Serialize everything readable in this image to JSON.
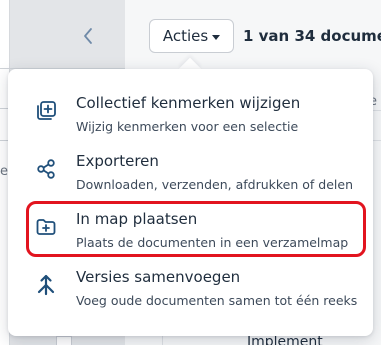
{
  "toolbar": {
    "actions_label": "Acties",
    "doc_count": "1 van 34 documen"
  },
  "menu": {
    "items": [
      {
        "icon": "collection-edit-icon",
        "title": "Collectief kenmerken wijzigen",
        "desc": "Wijzig kenmerken voor een selectie"
      },
      {
        "icon": "share-icon",
        "title": "Exporteren",
        "desc": "Downloaden, verzenden, afdrukken of delen"
      },
      {
        "icon": "folder-plus-icon",
        "title": "In map plaatsen",
        "desc": "Plaats de documenten in een verzamelmap"
      },
      {
        "icon": "merge-icon",
        "title": "Versies samenvoegen",
        "desc": "Voeg oude documenten samen tot één reeks"
      }
    ]
  },
  "background": {
    "bottom_text": "Implement",
    "left_letter": "e",
    "right_letter": "e"
  },
  "colors": {
    "highlight": "#e2141f",
    "accent": "#1f4f7a"
  }
}
